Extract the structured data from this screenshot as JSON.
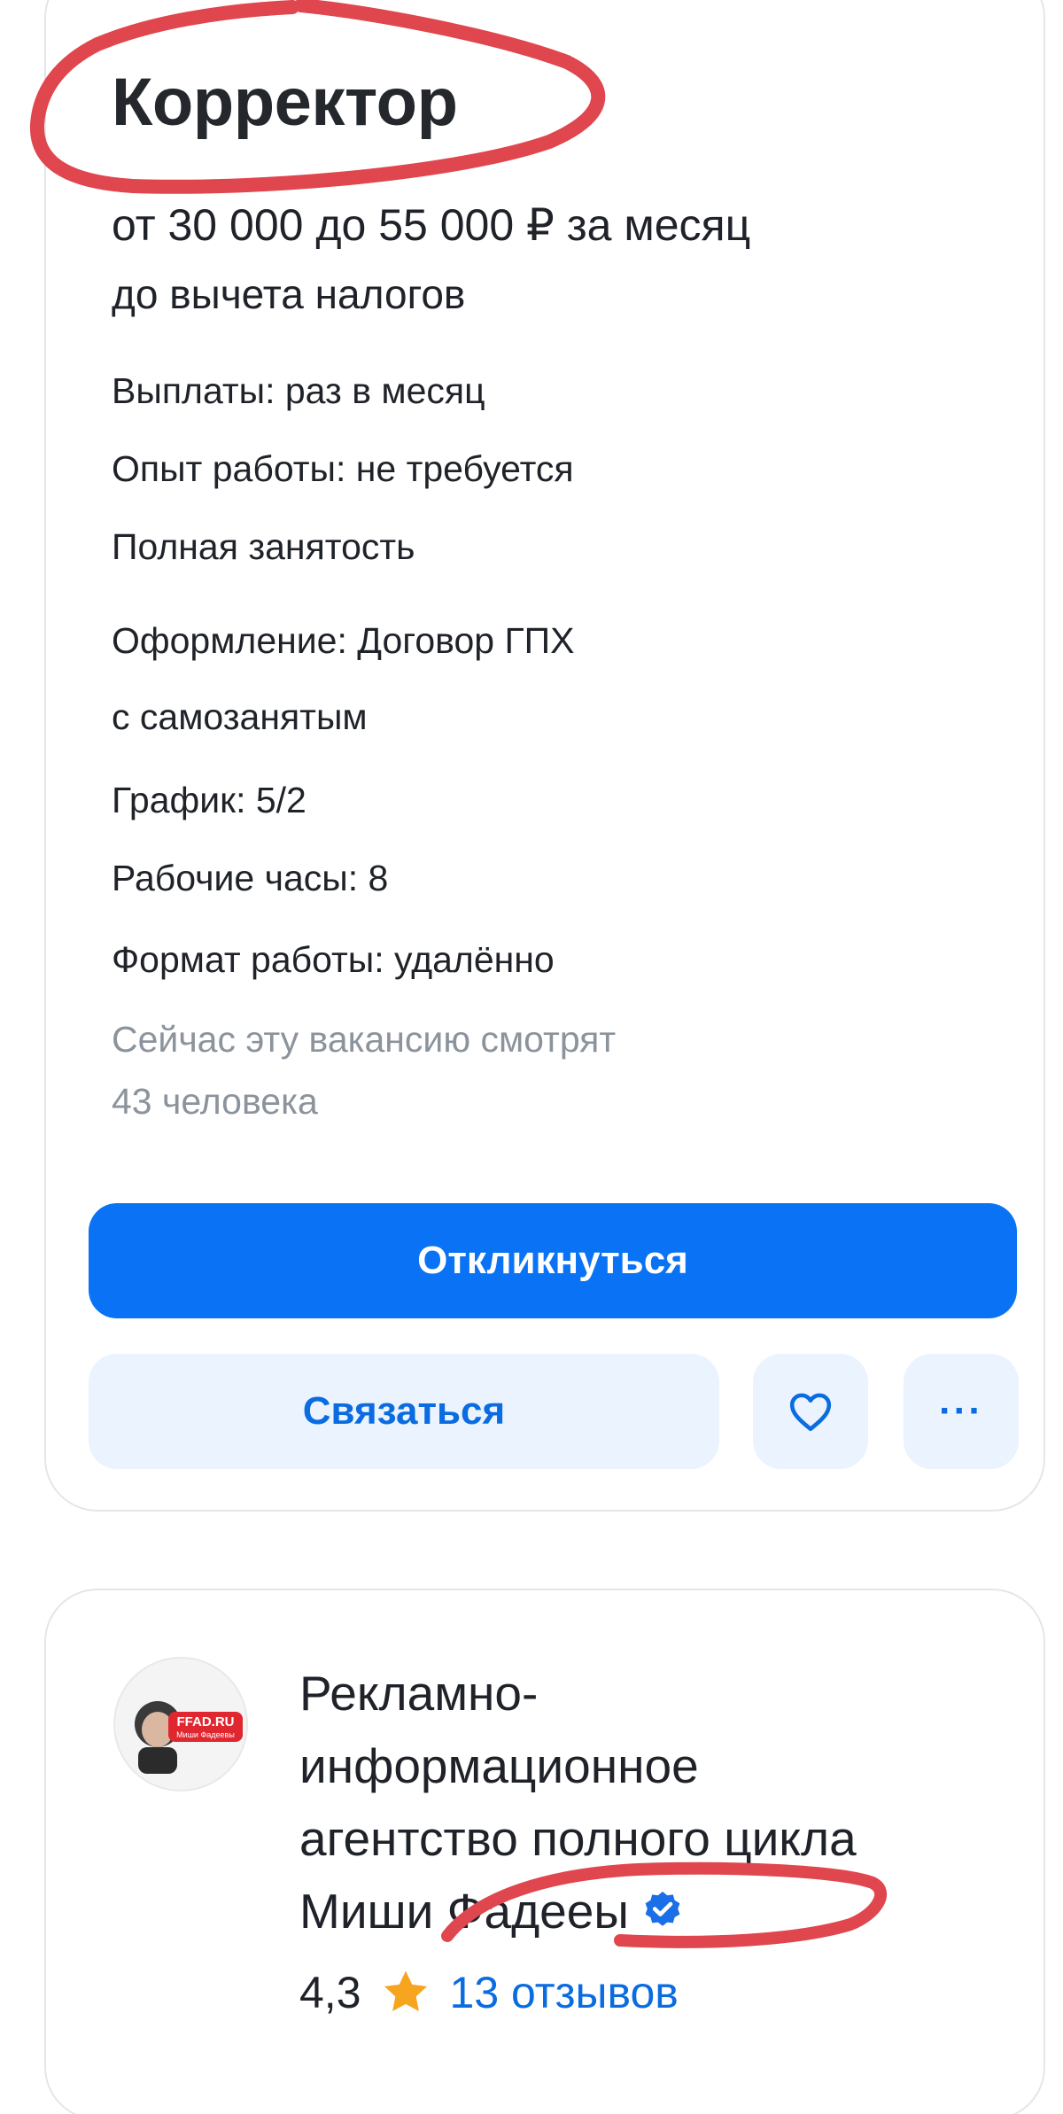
{
  "vacancy": {
    "title": "Корректор",
    "salary": "от 30 000 до 55 000 ₽ за месяц",
    "salary_note": "до вычета налогов",
    "details": [
      "Выплаты: раз в месяц",
      "Опыт работы: не требуется",
      "Полная занятость",
      "Оформление: Договор ГПХ",
      "с самозанятым",
      "График: 5/2",
      "Рабочие часы: 8",
      "Формат работы: удалённо"
    ],
    "viewers_line1": "Сейчас эту вакансию смотрят",
    "viewers_line2": "43 человека",
    "apply_label": "Откликнуться",
    "contact_label": "Связаться",
    "favorite_icon": "heart-icon",
    "more_label": "···"
  },
  "company": {
    "logo_text": "FFAD.RU",
    "logo_subtext": "Миши Фадеевы",
    "name_lines": [
      "Рекламно-",
      "информационное",
      "агентство полного цикла",
      "Миши Фадееы"
    ],
    "verified_icon": "verified-badge-icon",
    "rating": "4,3",
    "rating_icon": "star-icon",
    "reviews": "13 отзывов"
  },
  "colors": {
    "accent": "#0a73f5",
    "accent_soft": "#eaf3fe",
    "annotation": "#e0464e",
    "star": "#f7a41e"
  }
}
